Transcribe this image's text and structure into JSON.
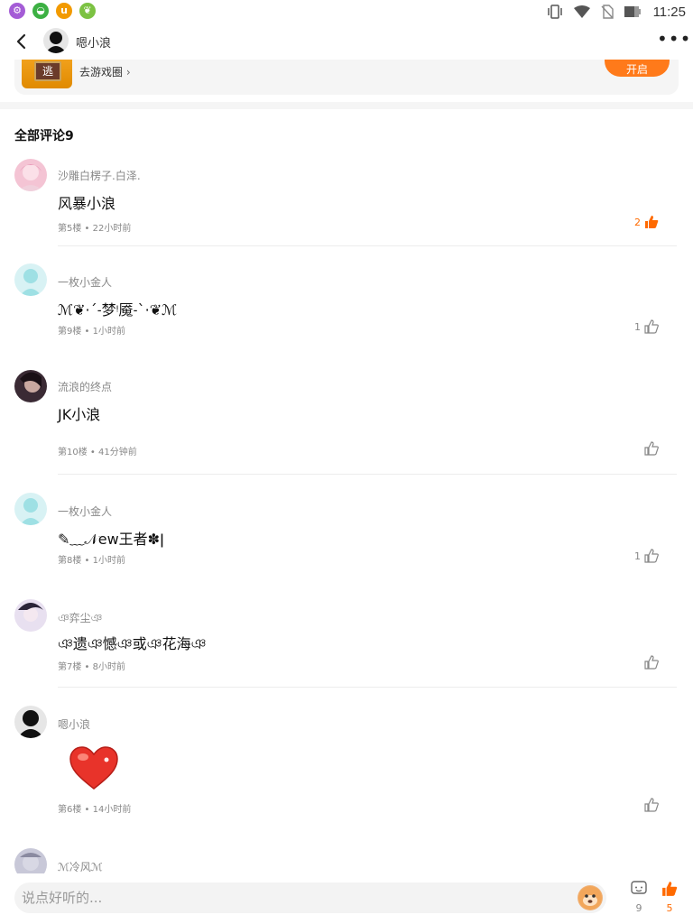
{
  "status_bar": {
    "time": "11:25",
    "apps": [
      {
        "icon": "gear-app-icon",
        "color": "#a45cd6",
        "glyph": "⚙"
      },
      {
        "icon": "green-app-icon",
        "color": "#3cb043",
        "glyph": "◒"
      },
      {
        "icon": "u-app-icon",
        "color": "#f29a00",
        "glyph": "u"
      },
      {
        "icon": "leaf-app-icon",
        "color": "#7cc242",
        "glyph": "❦"
      }
    ]
  },
  "header": {
    "title": "嗯小浪"
  },
  "game_card": {
    "icon_text": "逃",
    "link_label": "去游戏圈",
    "button_label": "开启"
  },
  "section": {
    "title": "全部评论9"
  },
  "comments": [
    {
      "user": "沙雕白楞子.白泽.",
      "text": "风暴小浪",
      "meta": "第5楼 • 22小时前",
      "likes": "2",
      "liked": true,
      "avatar_color": "#f4c4d4"
    },
    {
      "user": "一枚小金人",
      "text": "ℳ❦·ˊ˗梦ᵎ魇˗ˋ·❦ℳ",
      "meta": "第9楼 • 1小时前",
      "likes": "1",
      "liked": false,
      "avatar_color": "#9ee0e4"
    },
    {
      "user": "流浪的终点",
      "text": "JK小浪",
      "meta": "第10楼 • 41分钟前",
      "likes": "",
      "liked": false,
      "avatar_color": "#3a2a34"
    },
    {
      "user": "一枚小金人",
      "text": "✎﹏𝒩ew王者✽ǀ",
      "meta": "第8楼 • 1小时前",
      "likes": "1",
      "liked": false,
      "avatar_color": "#9ee0e4"
    },
    {
      "user": "ঞ弈尘ঞ",
      "text": "ঞ遗ঞ憾ঞ或ঞ花海ঞ",
      "meta": "第7楼 • 8小时前",
      "likes": "",
      "liked": false,
      "avatar_color": "#d8c8e8"
    },
    {
      "user": "嗯小浪",
      "text": "",
      "meta": "第6楼 • 14小时前",
      "likes": "",
      "liked": false,
      "avatar_color": "#e6e6e6",
      "sticker": "heart"
    },
    {
      "user": "ℳ冷风ℳ",
      "text": "",
      "meta": "",
      "likes": "",
      "liked": false,
      "avatar_color": "#c8c8d8"
    }
  ],
  "bottom_bar": {
    "input_placeholder": "说点好听的...",
    "comment_count": "9",
    "like_count": "5"
  },
  "colors": {
    "accent": "#ff6a00",
    "muted": "#888888"
  }
}
